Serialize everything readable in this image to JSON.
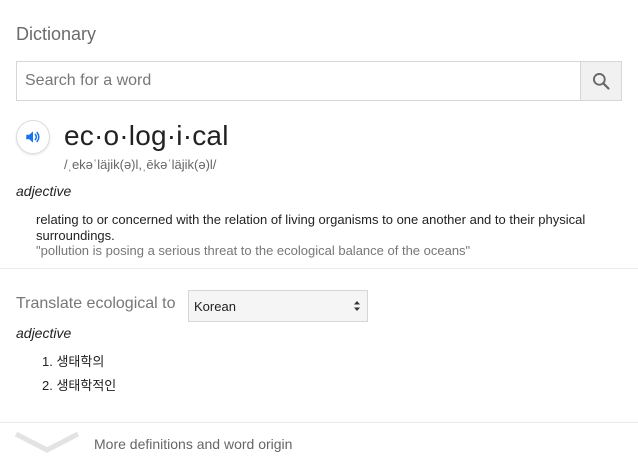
{
  "header": {
    "title": "Dictionary"
  },
  "search": {
    "placeholder": "Search for a word",
    "value": ""
  },
  "entry": {
    "headword": "ec·o·log·i·cal",
    "phonetic": "/ˌekəˈläjik(ə)l,ˌēkəˈläjik(ə)l/",
    "part_of_speech": "adjective",
    "definition": "relating to or concerned with the relation of living organisms to one another and to their physical surroundings.",
    "example": "\"pollution is posing a serious threat to the ecological balance of the oceans\""
  },
  "translate": {
    "label": "Translate ecological to",
    "selected_language": "Korean",
    "part_of_speech": "adjective",
    "items": [
      "1. 생태학의",
      "2. 생태학적인"
    ]
  },
  "footer": {
    "more_label": "More definitions and word origin"
  },
  "icons": {
    "search": "search-icon",
    "speaker": "speaker-icon",
    "expand": "chevron-down-icon",
    "select_arrows": "select-arrows-icon"
  },
  "colors": {
    "speaker_blue": "#1a73e8",
    "muted_text": "#777777"
  }
}
